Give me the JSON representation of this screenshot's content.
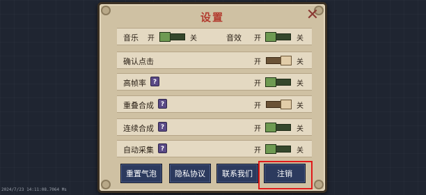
{
  "title": "设置",
  "toggle_on_text": "开",
  "toggle_off_text": "关",
  "rows": [
    {
      "label": "确认点击"
    },
    {
      "label": "高帧率",
      "help": "?"
    },
    {
      "label": "重叠合成",
      "help": "?"
    },
    {
      "label": "连续合成",
      "help": "?"
    },
    {
      "label": "自动采集",
      "help": "?"
    }
  ],
  "audio": {
    "music_label": "音乐",
    "sfx_label": "音效"
  },
  "buttons": {
    "reset_bubbles": "重置气泡",
    "privacy": "隐私协议",
    "contact": "联系我们",
    "logout": "注销"
  },
  "toggles": {
    "music": "on",
    "sfx": "on",
    "confirm_click": "off",
    "high_fps": "on",
    "overlap_merge": "off",
    "continuous_merge": "on",
    "auto_collect": "on"
  },
  "status_text": "2024/7/23 14:11:08.7064 Ms"
}
